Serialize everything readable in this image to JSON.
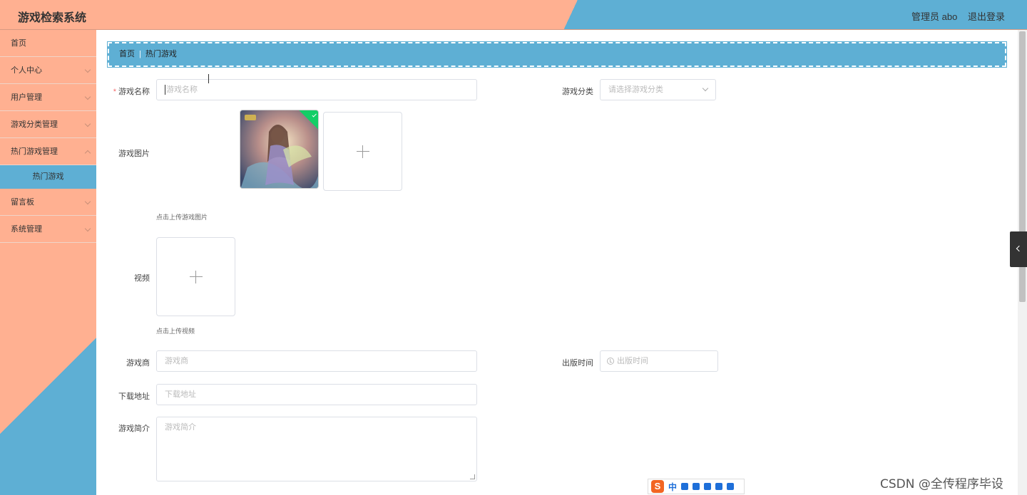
{
  "header": {
    "title": "游戏检索系统",
    "user": "管理员 abo",
    "logout": "退出登录",
    "colors": {
      "salmon": "#ffb091",
      "blue": "#5eafd4"
    }
  },
  "sidebar": {
    "items": [
      {
        "label": "首页"
      },
      {
        "label": "个人中心"
      },
      {
        "label": "用户管理"
      },
      {
        "label": "游戏分类管理"
      },
      {
        "label": "热门游戏管理"
      },
      {
        "label": "热门游戏"
      },
      {
        "label": "留言板"
      },
      {
        "label": "系统管理"
      }
    ]
  },
  "breadcrumb": {
    "home": "首页",
    "current": "热门游戏"
  },
  "form": {
    "name": {
      "label": "游戏名称",
      "placeholder": "游戏名称"
    },
    "category": {
      "label": "游戏分类",
      "placeholder": "请选择游戏分类"
    },
    "image": {
      "label": "游戏图片",
      "hint": "点击上传游戏图片"
    },
    "video": {
      "label": "视频",
      "hint": "点击上传视频"
    },
    "developer": {
      "label": "游戏商",
      "placeholder": "游戏商"
    },
    "release": {
      "label": "出版时间",
      "placeholder": "出版时间"
    },
    "download": {
      "label": "下载地址",
      "placeholder": "下载地址"
    },
    "intro": {
      "label": "游戏简介",
      "placeholder": "游戏简介"
    }
  },
  "ime": {
    "logo": "S",
    "lang": "中"
  },
  "watermark": "CSDN @全传程序毕设"
}
